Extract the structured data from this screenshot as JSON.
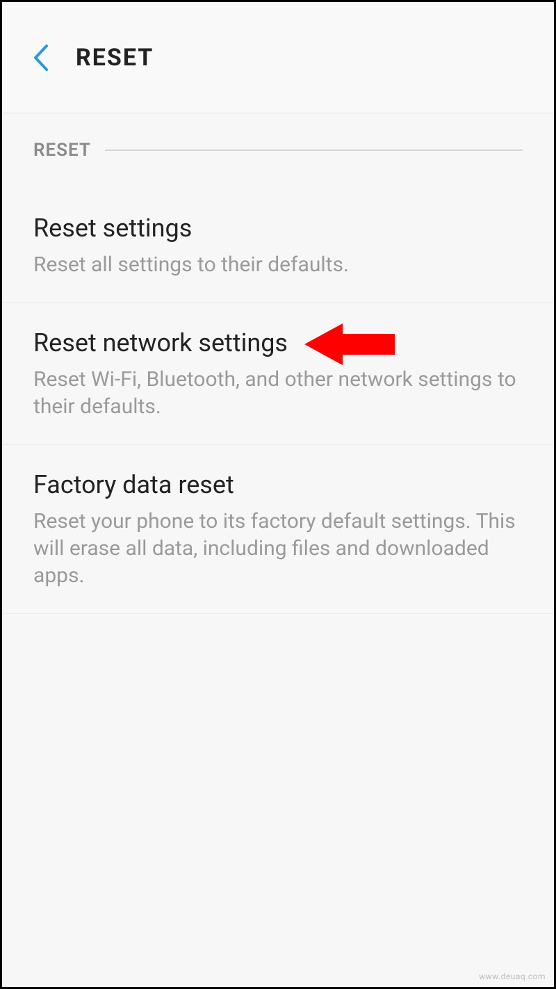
{
  "header": {
    "title": "RESET"
  },
  "section": {
    "label": "RESET"
  },
  "items": [
    {
      "title": "Reset settings",
      "desc": "Reset all settings to their defaults."
    },
    {
      "title": "Reset network settings",
      "desc": "Reset Wi-Fi, Bluetooth, and other network settings to their defaults."
    },
    {
      "title": "Factory data reset",
      "desc": "Reset your phone to its factory default settings. This will erase all data, including files and downloaded apps."
    }
  ],
  "watermark": "www.deuaq.com",
  "annotation": {
    "arrow_color": "#ff0000"
  }
}
